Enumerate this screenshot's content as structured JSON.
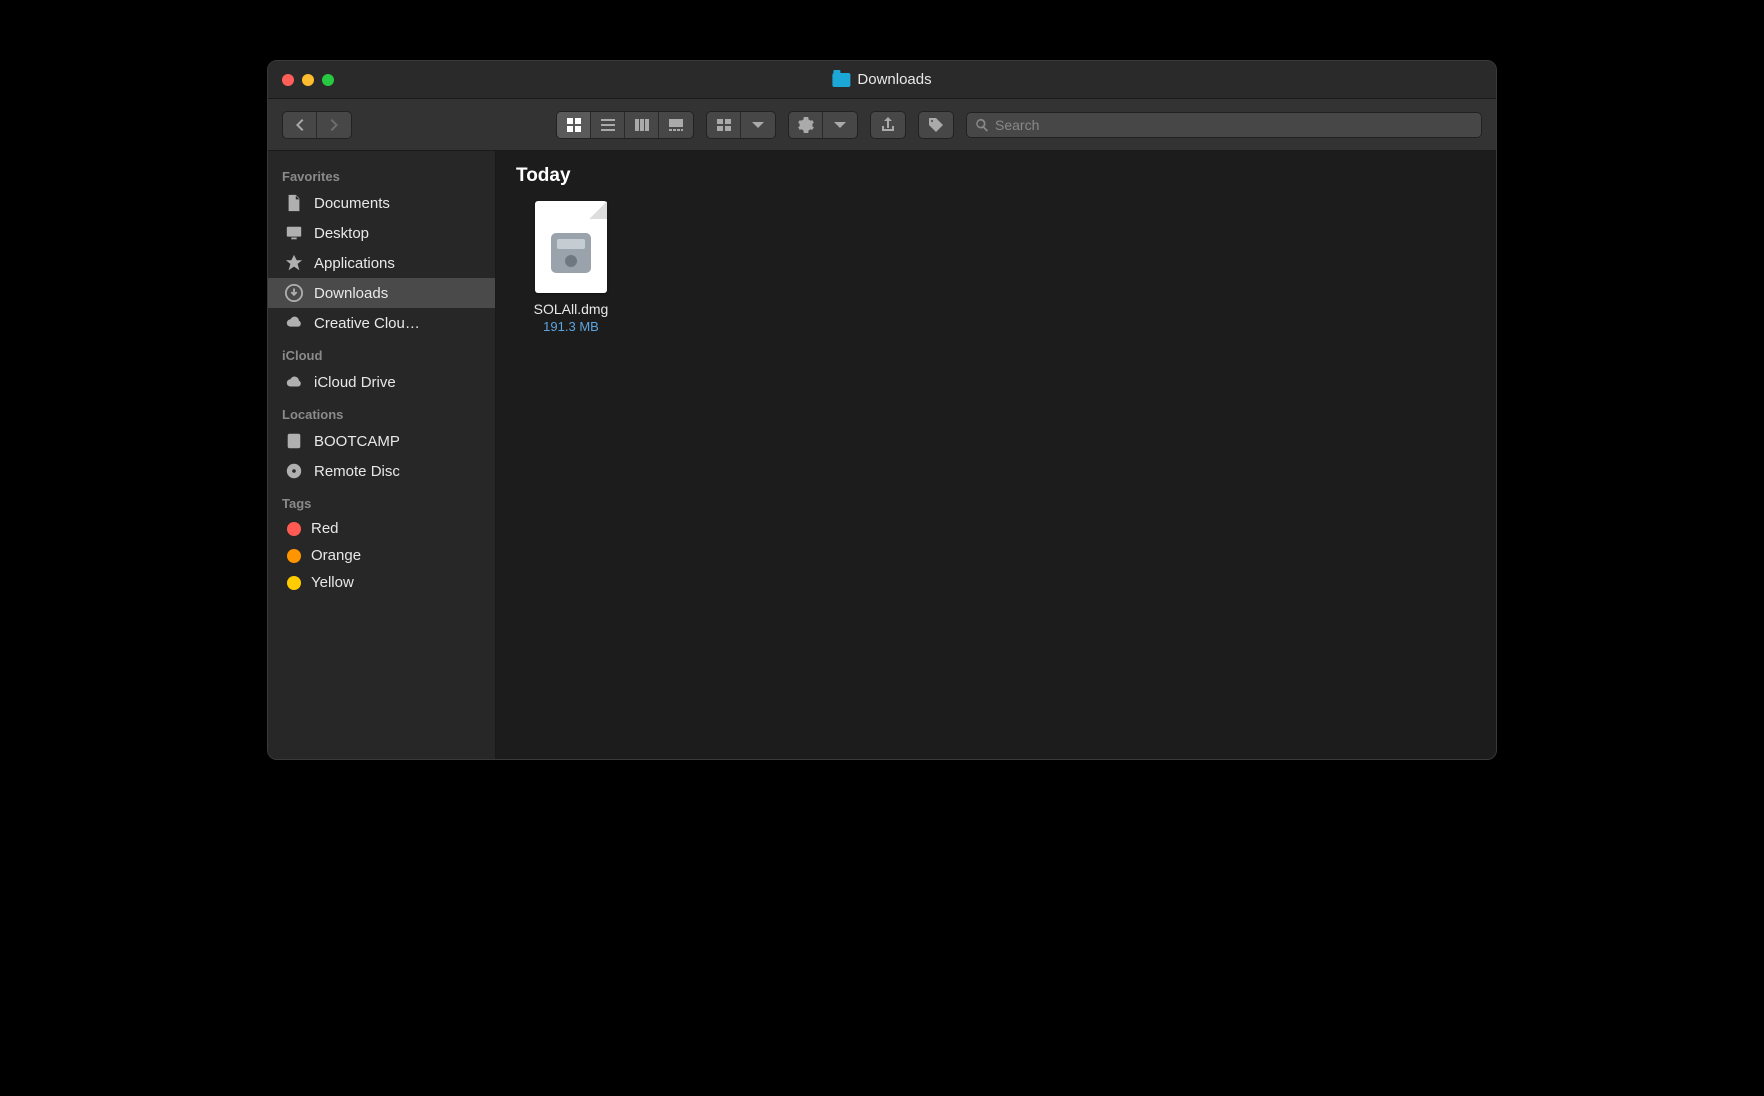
{
  "window": {
    "title": "Downloads"
  },
  "search": {
    "placeholder": "Search"
  },
  "sidebar": {
    "sections": [
      {
        "header": "Favorites",
        "items": [
          {
            "label": "Documents",
            "icon": "document",
            "selected": false
          },
          {
            "label": "Desktop",
            "icon": "desktop",
            "selected": false
          },
          {
            "label": "Applications",
            "icon": "applications",
            "selected": false
          },
          {
            "label": "Downloads",
            "icon": "downloads",
            "selected": true
          },
          {
            "label": "Creative Clou…",
            "icon": "creative-cloud",
            "selected": false
          }
        ]
      },
      {
        "header": "iCloud",
        "items": [
          {
            "label": "iCloud Drive",
            "icon": "icloud",
            "selected": false
          }
        ]
      },
      {
        "header": "Locations",
        "items": [
          {
            "label": "BOOTCAMP",
            "icon": "disk",
            "selected": false
          },
          {
            "label": "Remote Disc",
            "icon": "disc",
            "selected": false
          }
        ]
      },
      {
        "header": "Tags",
        "items": [
          {
            "label": "Red",
            "icon": "tag",
            "color": "#ff5b52",
            "selected": false
          },
          {
            "label": "Orange",
            "icon": "tag",
            "color": "#ff9500",
            "selected": false
          },
          {
            "label": "Yellow",
            "icon": "tag",
            "color": "#ffcc00",
            "selected": false
          }
        ]
      }
    ]
  },
  "content": {
    "group_header": "Today",
    "files": [
      {
        "name": "SOLAll.dmg",
        "size": "191.3 MB",
        "type": "dmg"
      }
    ]
  }
}
